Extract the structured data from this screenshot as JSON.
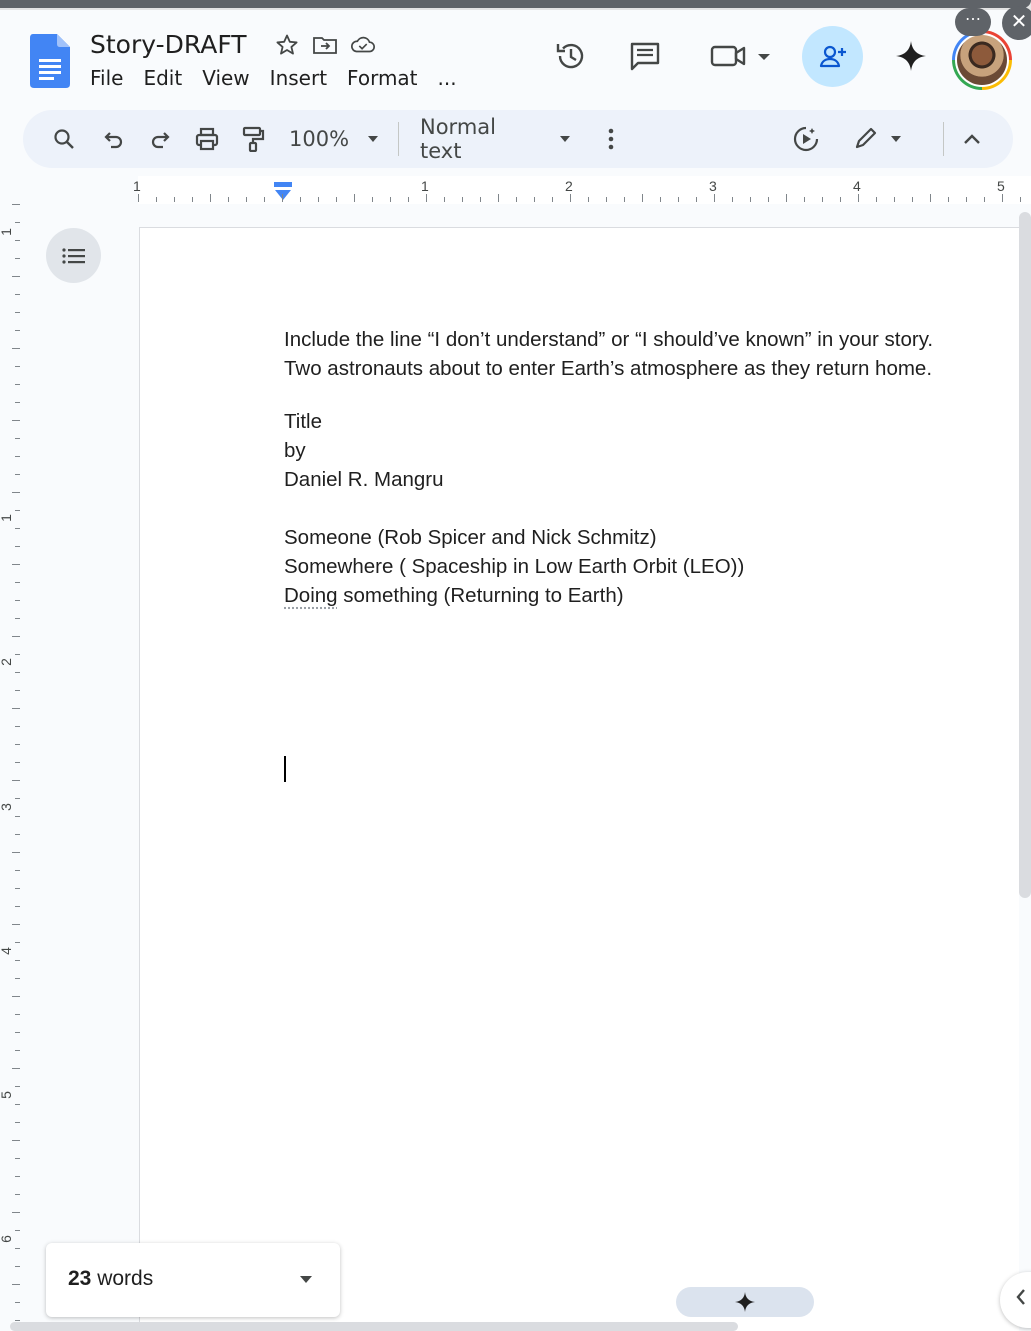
{
  "app": {
    "doc_title": "Story-DRAFT",
    "menus": [
      "File",
      "Edit",
      "View",
      "Insert",
      "Format",
      "..."
    ],
    "icons": {
      "star": "star-icon",
      "move": "move-to-folder-icon",
      "cloud": "cloud-saved-icon",
      "history": "version-history-icon",
      "comments": "comments-icon",
      "meet": "meet-video-icon",
      "share": "share-add-person-icon",
      "gemini": "gemini-sparkle-icon"
    },
    "more_badge": "⋯",
    "close_badge": "✕"
  },
  "toolbar": {
    "zoom": "100%",
    "style": "Normal text"
  },
  "ruler": {
    "h_numbers": [
      "1",
      "1",
      "2",
      "3",
      "4",
      "5"
    ],
    "v_numbers": [
      "1",
      "1",
      "2",
      "3",
      "4",
      "5",
      "6"
    ]
  },
  "document": {
    "lines": {
      "l1": "Include the line “I don’t understand” or “I should’ve known” in your story.",
      "l2": "Two astronauts about to enter Earth’s atmosphere as they return home.",
      "l3": "Title",
      "l4": "by",
      "l5": "Daniel R. Mangru",
      "l6": "Someone (Rob Spicer and Nick Schmitz)",
      "l7": "Somewhere ( Spaceship in Low Earth Orbit (LEO))",
      "l8a": "Doing",
      "l8b": " something (Returning to Earth)"
    }
  },
  "wordcount": {
    "count": "23",
    "unit": " words"
  },
  "colors": {
    "accent": "#1a73e8",
    "share_bg": "#c2e7ff",
    "toolbar_bg": "#edf2fa"
  }
}
